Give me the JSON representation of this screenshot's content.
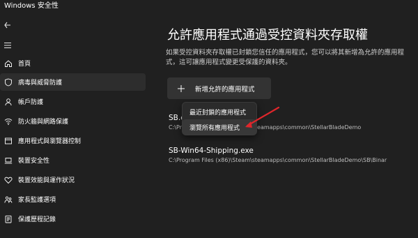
{
  "window": {
    "title": "Windows 安全性"
  },
  "sidebar": {
    "items": [
      {
        "label": "首頁",
        "icon": "home-icon"
      },
      {
        "label": "病毒與威脅防護",
        "icon": "shield-icon",
        "active": true
      },
      {
        "label": "帳戶防護",
        "icon": "person-icon"
      },
      {
        "label": "防火牆與網路保護",
        "icon": "wifi-icon"
      },
      {
        "label": "應用程式與瀏覽器控制",
        "icon": "app-browser-icon"
      },
      {
        "label": "裝置安全性",
        "icon": "laptop-icon"
      },
      {
        "label": "裝置效能與運作狀況",
        "icon": "heart-icon"
      },
      {
        "label": "家長監護選項",
        "icon": "family-icon"
      },
      {
        "label": "保護歷程記錄",
        "icon": "history-icon"
      }
    ]
  },
  "main": {
    "title": "允許應用程式通過受控資料夾存取權",
    "description": "如果受控資料夾存取權已封鎖您信任的應用程式，您可以將其新增為允許的應用程式，這可讓應用程式變更受保護的資料夾。",
    "add_button_label": "新增允許的應用程式",
    "apps": [
      {
        "name": "SB.exe",
        "path": "C:\\Program Files (x86)\\Steam\\steamapps\\common\\StellarBladeDemo"
      },
      {
        "name": "SB-Win64-Shipping.exe",
        "path": "C:\\Program Files (x86)\\Steam\\steamapps\\common\\StellarBladeDemo\\SB\\Binar"
      }
    ]
  },
  "dropdown": {
    "items": [
      {
        "label": "最近封鎖的應用程式"
      },
      {
        "label": "瀏覽所有應用程式",
        "hover": true
      }
    ]
  },
  "colors": {
    "background": "#202020",
    "annotation_arrow": "#e0262b"
  }
}
